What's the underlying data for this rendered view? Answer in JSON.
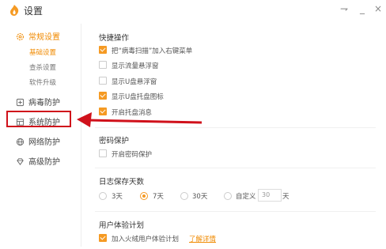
{
  "window": {
    "title": "设置"
  },
  "titlebar": {
    "menu_glyph": "⇁",
    "minimize_glyph": "_",
    "close_glyph": "×"
  },
  "sidebar": {
    "general": "常规设置",
    "general_subs": [
      "基础设置",
      "查杀设置",
      "软件升级"
    ],
    "items": [
      "病毒防护",
      "系统防护",
      "网络防护",
      "高级防护"
    ]
  },
  "quick_ops": {
    "title": "快捷操作",
    "options": [
      {
        "label": "把“病毒扫描”加入右键菜单",
        "checked": true
      },
      {
        "label": "显示流量悬浮窗",
        "checked": false
      },
      {
        "label": "显示U盘悬浮窗",
        "checked": false
      },
      {
        "label": "显示U盘托盘图标",
        "checked": true
      },
      {
        "label": "开启托盘消息",
        "checked": true
      }
    ]
  },
  "password": {
    "title": "密码保护",
    "option": {
      "label": "开启密码保护",
      "checked": false
    }
  },
  "log": {
    "title": "日志保存天数",
    "options": [
      "3天",
      "7天",
      "30天",
      "自定义"
    ],
    "selected": "7天",
    "custom_placeholder": "30",
    "custom_unit": "天"
  },
  "ux_plan": {
    "title": "用户体验计划",
    "option": {
      "label": "加入火绒用户体验计划",
      "checked": true
    },
    "link": "了解详情"
  },
  "colors": {
    "accent": "#f59a23",
    "annotation": "#d0111b"
  }
}
